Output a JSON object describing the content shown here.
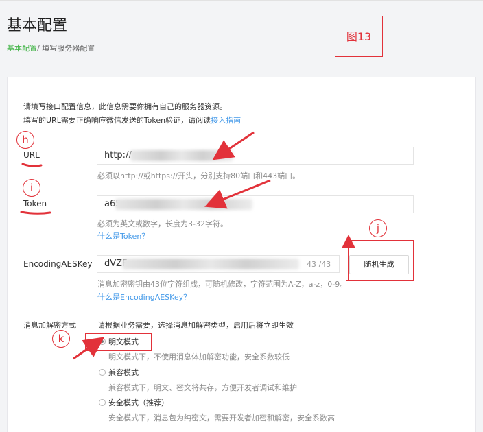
{
  "header": {
    "title": "基本配置",
    "breadcrumb_current": "基本配置",
    "breadcrumb_separator": "/",
    "breadcrumb_page": "填写服务器配置",
    "figure_label": "图13"
  },
  "intro": {
    "line1": "请填写接口配置信息，此信息需要你拥有自己的服务器资源。",
    "line2_prefix": "填写的URL需要正确响应微信发送的Token验证，请阅读",
    "line2_link": "接入指南"
  },
  "url": {
    "label": "URL",
    "value": "http://",
    "hint": "必须以http://或https://开头，分别支持80端口和443端口。"
  },
  "token": {
    "label": "Token",
    "value": "a65",
    "hint": "必须为英文或数字，长度为3-32字符。",
    "help": "什么是Token？"
  },
  "aeskey": {
    "label": "EncodingAESKey",
    "value": "dVZF",
    "count": "43 /43",
    "generate_button": "随机生成",
    "hint": "消息加密密钥由43位字符组成，可随机修改，字符范围为A-Z，a-z，0-9。",
    "help": "什么是EncodingAESKey？"
  },
  "encryption": {
    "label": "消息加解密方式",
    "description": "请根据业务需要，选择消息加解密类型，启用后将立即生效",
    "options": [
      {
        "label": "明文模式",
        "desc": "明文模式下，不使用消息体加解密功能，安全系数较低",
        "checked": true
      },
      {
        "label": "兼容模式",
        "desc": "兼容模式下，明文、密文将共存，方便开发者调试和维护",
        "checked": false
      },
      {
        "label": "安全模式（推荐）",
        "desc": "安全模式下，消息包为纯密文，需要开发者加密和解密，安全系数高",
        "checked": false
      }
    ]
  },
  "annotations": {
    "h": "h",
    "i": "i",
    "j": "j",
    "k": "k",
    "accent_color": "#e2323a"
  },
  "colors": {
    "green_accent": "#44b549",
    "link_blue": "#459ae9"
  }
}
